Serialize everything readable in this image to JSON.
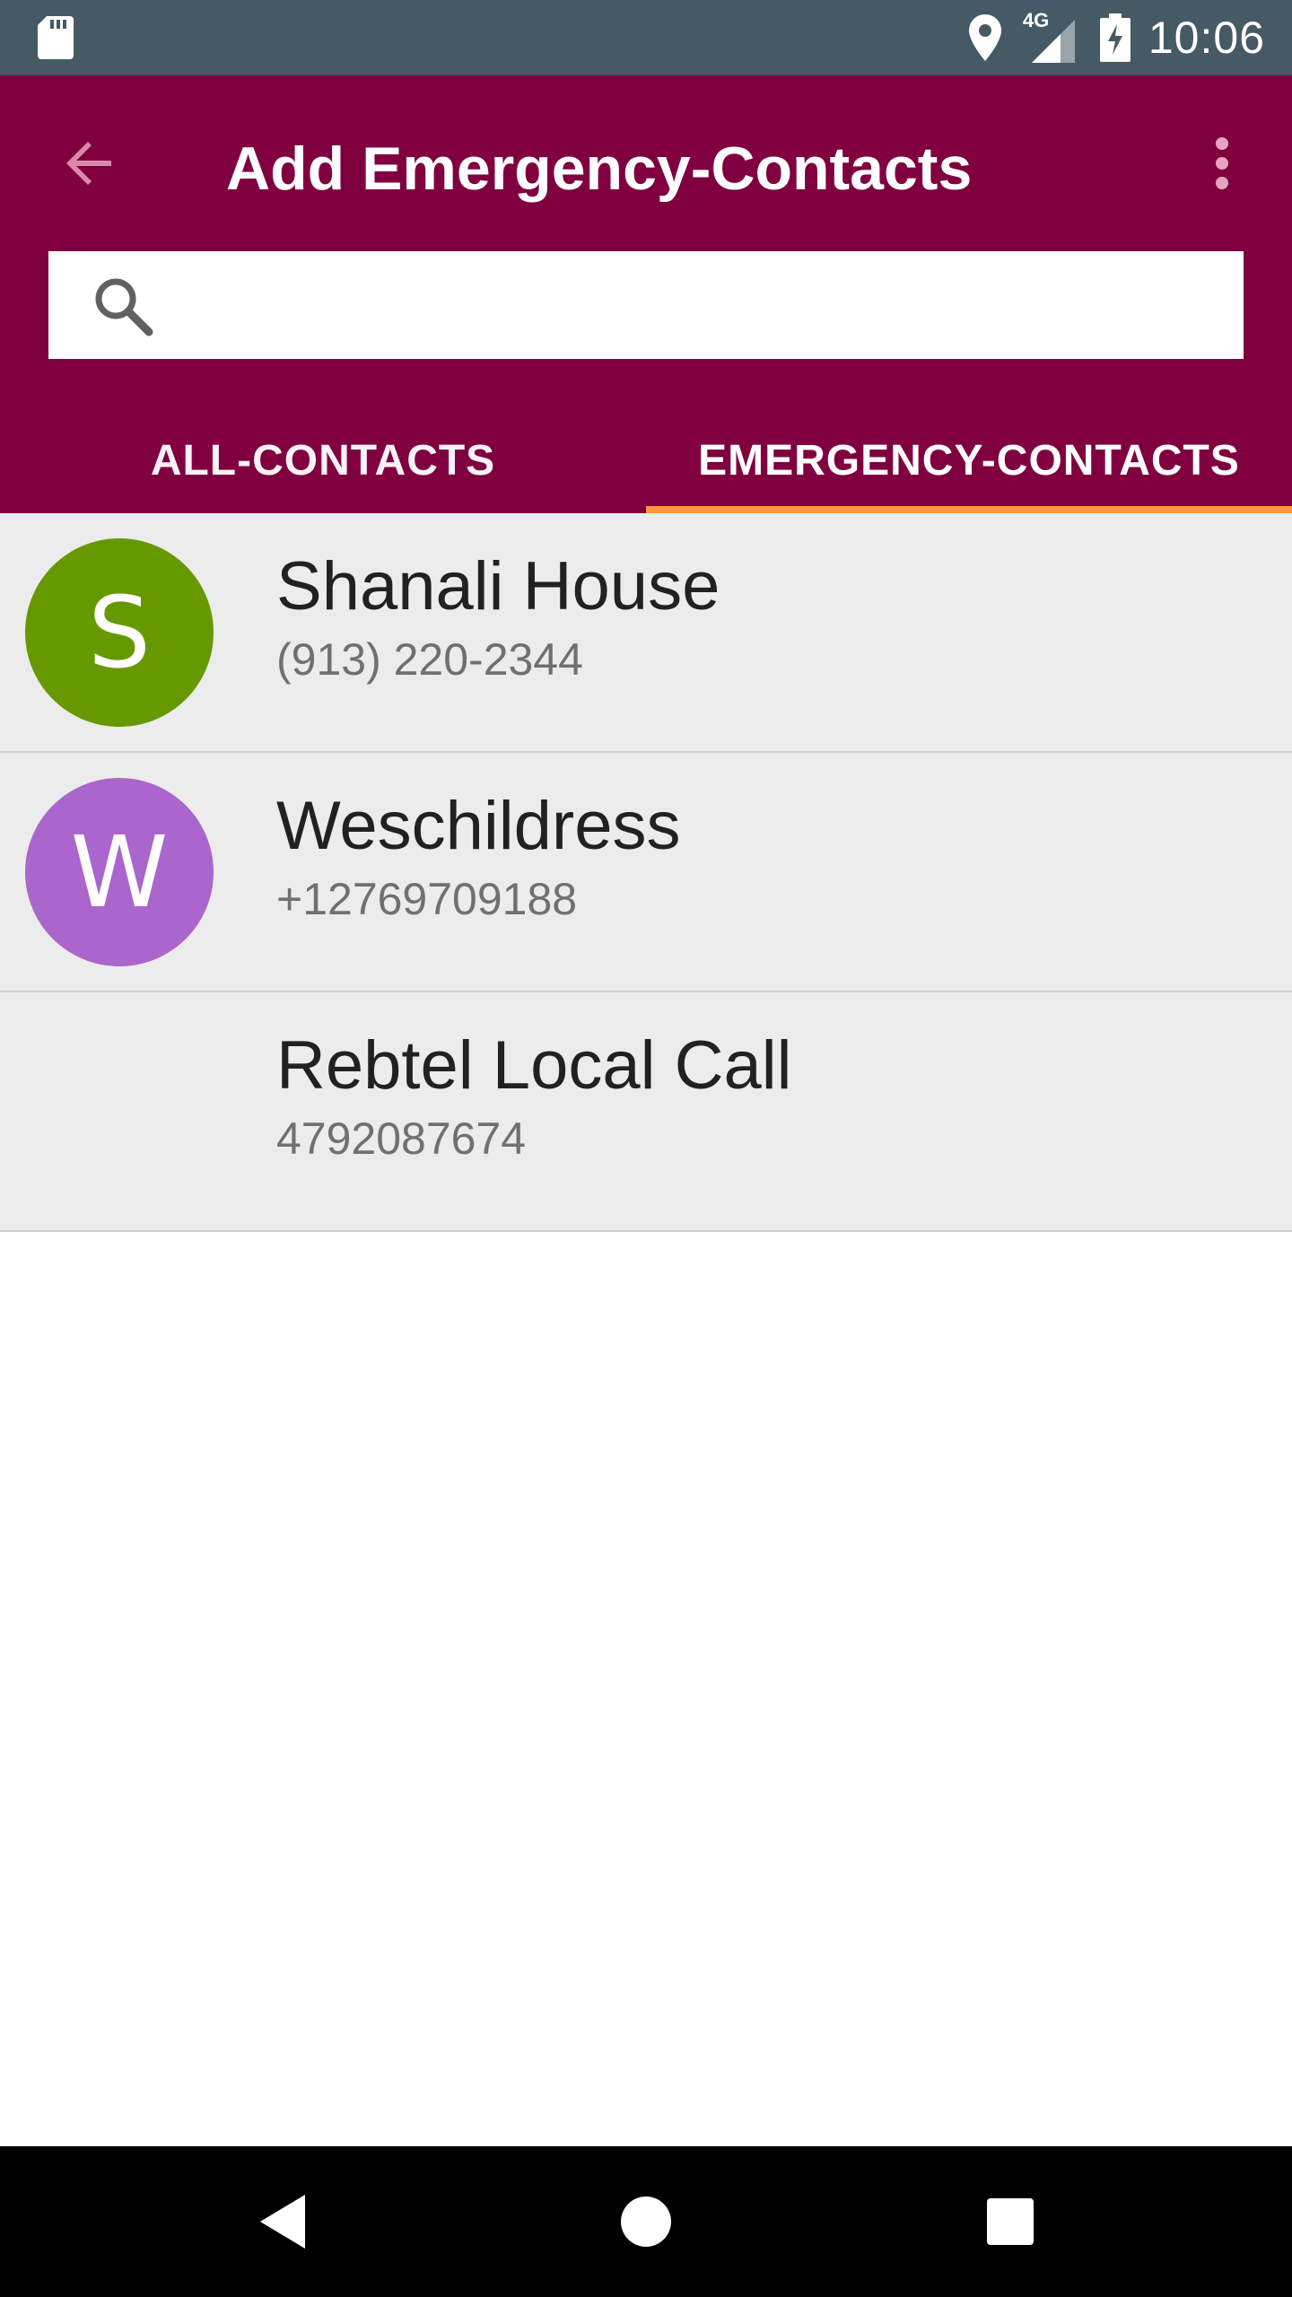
{
  "status_bar": {
    "time": "10:06",
    "network": "4G",
    "icons": [
      "sd-card-icon",
      "location-icon",
      "signal-icon",
      "battery-charging-icon"
    ]
  },
  "app_bar": {
    "title": "Add Emergency-Contacts",
    "back_icon": "arrow-back-icon",
    "menu_icon": "more-vert-icon",
    "background": "#80003f"
  },
  "search": {
    "placeholder": "",
    "value": "",
    "icon": "search-icon"
  },
  "tabs": [
    {
      "label": "ALL-CONTACTS",
      "selected": false
    },
    {
      "label": "EMERGENCY-CONTACTS",
      "selected": true
    }
  ],
  "tab_indicator_color": "#ff9a3c",
  "contacts": [
    {
      "initial": "S",
      "name": "Shanali House",
      "phone": "(913) 220-2344",
      "avatar_color": "#669900"
    },
    {
      "initial": "W",
      "name": "Weschildress",
      "phone": "+12769709188",
      "avatar_color": "#aa66cc"
    },
    {
      "initial": "",
      "name": "Rebtel Local Call",
      "phone": "4792087674",
      "avatar_color": ""
    }
  ],
  "nav_bar": {
    "icons": [
      "nav-back-icon",
      "nav-home-icon",
      "nav-recents-icon"
    ]
  }
}
